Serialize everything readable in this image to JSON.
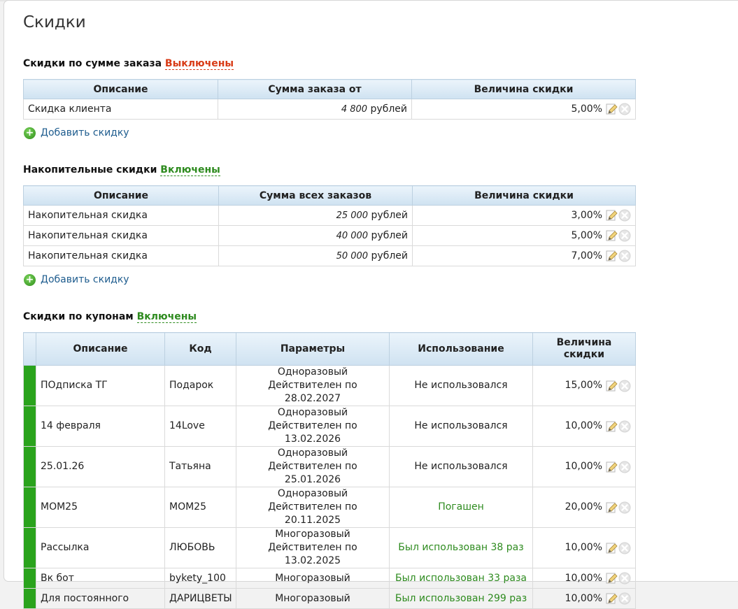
{
  "page": {
    "title": "Скидки"
  },
  "order_sum_section": {
    "title": "Скидки по сумме заказа",
    "state": "Выключены",
    "columns": [
      "Описание",
      "Сумма заказа от",
      "Величина скидки"
    ],
    "rows": [
      {
        "description": "Скидка клиента",
        "amount": "4 800",
        "currency": "рублей",
        "discount": "5,00%"
      }
    ],
    "add_label": "Добавить скидку"
  },
  "cumulative_section": {
    "title": "Накопительные скидки",
    "state": "Включены",
    "columns": [
      "Описание",
      "Сумма всех заказов",
      "Величина скидки"
    ],
    "rows": [
      {
        "description": "Накопительная скидка",
        "amount": "25 000",
        "currency": "рублей",
        "discount": "3,00%"
      },
      {
        "description": "Накопительная скидка",
        "amount": "40 000",
        "currency": "рублей",
        "discount": "5,00%"
      },
      {
        "description": "Накопительная скидка",
        "amount": "50 000",
        "currency": "рублей",
        "discount": "7,00%"
      }
    ],
    "add_label": "Добавить скидку"
  },
  "coupon_section": {
    "title": "Скидки по купонам",
    "state": "Включены",
    "columns": [
      "Описание",
      "Код",
      "Параметры",
      "Использование",
      "Величина скидки"
    ],
    "rows": [
      {
        "description": "ПОдписка ТГ",
        "code": "Подарок",
        "param_type": "Одноразовый",
        "param_valid": "Действителен по 28.02.2027",
        "usage": "Не использовался",
        "usage_status": "unused",
        "discount": "15,00%"
      },
      {
        "description": "14 февраля",
        "code": "14Love",
        "param_type": "Одноразовый",
        "param_valid": "Действителен по 13.02.2026",
        "usage": "Не использовался",
        "usage_status": "unused",
        "discount": "10,00%"
      },
      {
        "description": "25.01.26",
        "code": "Татьяна",
        "param_type": "Одноразовый",
        "param_valid": "Действителен по 25.01.2026",
        "usage": "Не использовался",
        "usage_status": "unused",
        "discount": "10,00%"
      },
      {
        "description": "MOM25",
        "code": "MOM25",
        "param_type": "Одноразовый",
        "param_valid": "Действителен по 20.11.2025",
        "usage": "Погашен",
        "usage_status": "used",
        "discount": "20,00%"
      },
      {
        "description": "Рассылка",
        "code": "ЛЮБОВЬ",
        "param_type": "Многоразовый",
        "param_valid": "Действителен по 13.02.2025",
        "usage": "Был использован 38 раз",
        "usage_status": "used",
        "discount": "10,00%"
      },
      {
        "description": "Вк бот",
        "code": "bykety_100",
        "param_type": "Многоразовый",
        "param_valid": "",
        "usage": "Был использован 33 раза",
        "usage_status": "used",
        "discount": "10,00%"
      },
      {
        "description": "Для постоянного",
        "code": "ДАРИЦВЕТЫ",
        "param_type": "Многоразовый",
        "param_valid": "",
        "usage": "Был использован 299 раз",
        "usage_status": "used",
        "discount": "10,00%"
      }
    ]
  },
  "colors": {
    "state_off": "#d83b16",
    "state_on": "#2e8b1f",
    "active_bar": "#2aa31c",
    "header_bg": "#cfe2f1",
    "link": "#1e5c8e"
  },
  "icons": {
    "edit": "pencil-edit-icon",
    "delete": "delete-x-icon",
    "add": "plus-circle-icon"
  }
}
